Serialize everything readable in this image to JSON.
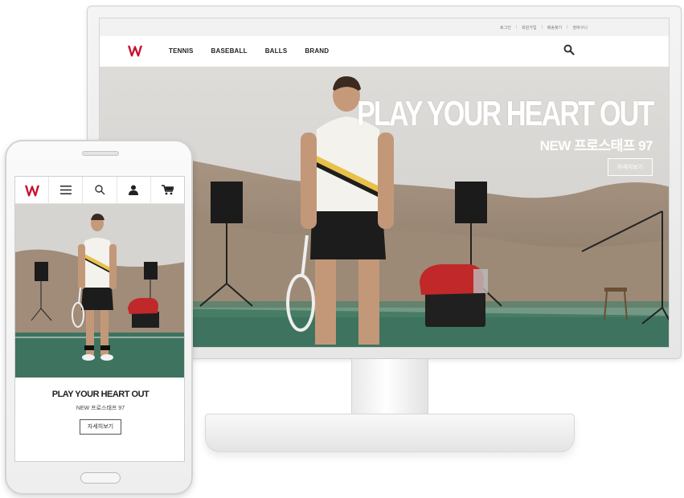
{
  "desktop": {
    "utility_links": [
      "로그인",
      "회원가입",
      "배송찾기",
      "장바구니"
    ],
    "logo": "W",
    "nav_items": [
      "TENNIS",
      "BASEBALL",
      "BALLS",
      "BRAND"
    ],
    "search_icon": "search-icon",
    "hero": {
      "title": "PLAY YOUR HEART OUT",
      "subtitle": "NEW 프로스태프 97",
      "button_label": "자세히보기"
    }
  },
  "mobile": {
    "logo": "W",
    "icons": [
      "menu-icon",
      "search-icon",
      "user-icon",
      "cart-icon"
    ],
    "hero": {
      "title": "PLAY YOUR HEART OUT",
      "subtitle": "NEW 프로스태프 97",
      "button_label": "자세히보기"
    }
  },
  "colors": {
    "brand_red": "#c8102e",
    "court_green": "#3e7360",
    "sky": "#d7d5d2"
  }
}
